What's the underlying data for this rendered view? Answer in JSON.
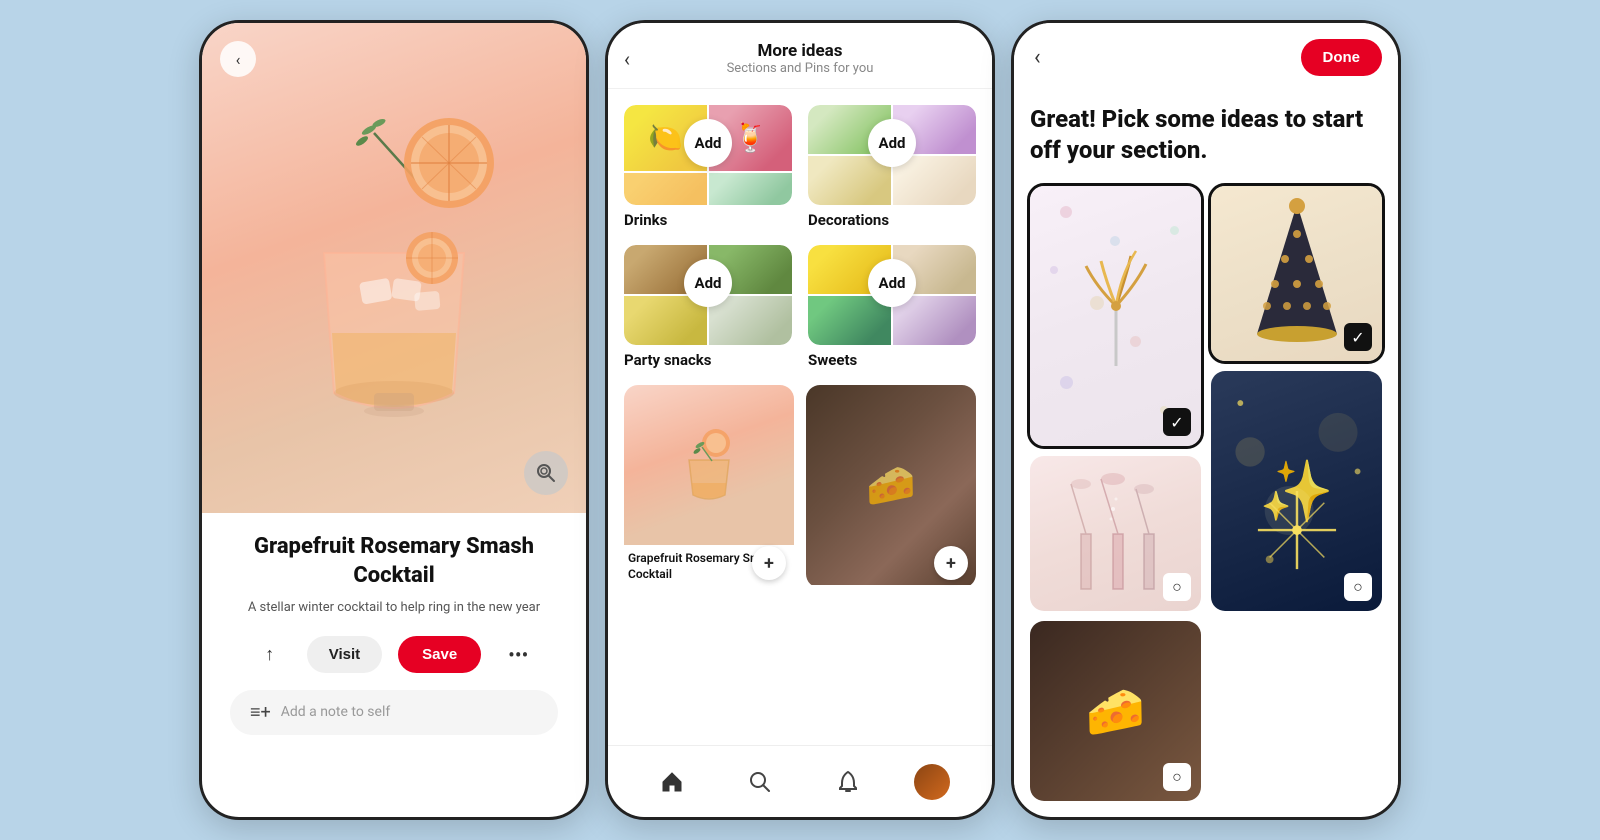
{
  "app": {
    "background_color": "#b8d4e8"
  },
  "screen1": {
    "back_label": "‹",
    "lens_icon": "⊙",
    "title": "Grapefruit Rosemary Smash Cocktail",
    "description": "A stellar winter cocktail to help ring in the new year",
    "visit_label": "Visit",
    "save_label": "Save",
    "more_icon": "•••",
    "share_icon": "↑",
    "note_placeholder": "Add a note to self",
    "note_icon": "≡+"
  },
  "screen2": {
    "back_label": "‹",
    "header_title": "More ideas",
    "header_sub": "Sections and Pins for you",
    "sections": [
      {
        "label": "Drinks",
        "add_label": "Add"
      },
      {
        "label": "Decorations",
        "add_label": "Add"
      },
      {
        "label": "Party snacks",
        "add_label": "Add"
      },
      {
        "label": "Sweets",
        "add_label": "Add"
      }
    ],
    "pins": [
      {
        "caption": "Grapefruit Rosemary Smash Cocktail"
      },
      {
        "caption": ""
      }
    ],
    "nav": {
      "home_icon": "⌂",
      "search_icon": "🔍",
      "bell_icon": "🔔"
    }
  },
  "screen3": {
    "back_label": "‹",
    "done_label": "Done",
    "title": "Great! Pick some ideas to start off your section.",
    "ideas": [
      {
        "type": "confetti-stick",
        "selected": true
      },
      {
        "type": "party-hat",
        "selected": true
      },
      {
        "type": "champagne",
        "selected": false
      },
      {
        "type": "sparkle",
        "selected": false
      },
      {
        "type": "cheese",
        "selected": false
      }
    ]
  }
}
